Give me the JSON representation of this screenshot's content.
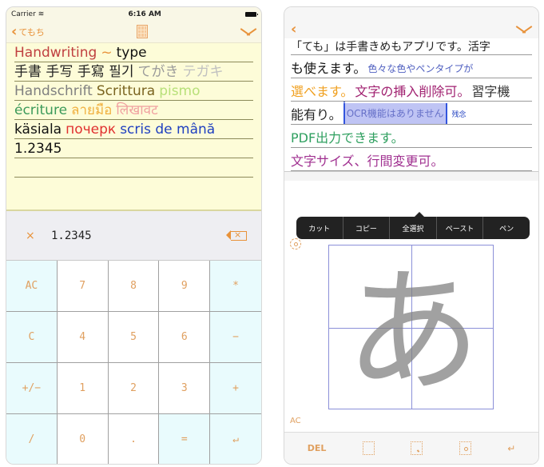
{
  "left": {
    "status": {
      "carrier": "Carrier",
      "wifi_icon": "wifi-icon",
      "time": "6:16 AM",
      "battery_icon": "battery-icon"
    },
    "nav": {
      "back_label": "てもち",
      "calc_icon": "calculator-icon",
      "collapse_icon": "chevron-down-icon"
    },
    "note_lines": [
      [
        {
          "text": "Handwriting",
          "color": "#c04040"
        },
        {
          "text": "~",
          "color": "#e8923a"
        },
        {
          "text": "type",
          "color": "#111111"
        }
      ],
      [
        {
          "text": "手書 手写 手寫 필기",
          "color": "#222222"
        },
        {
          "text": "てがき",
          "color": "#9a9a9a"
        },
        {
          "text": "テガキ",
          "color": "#c0c0c0"
        }
      ],
      [
        {
          "text": "Handschrift",
          "color": "#808080"
        },
        {
          "text": "Scrittura",
          "color": "#7a6420"
        },
        {
          "text": "pismo",
          "color": "#b8e07a"
        }
      ],
      [
        {
          "text": "écriture",
          "color": "#3c9a5a"
        },
        {
          "text": "ลายมือ",
          "color": "#f0b040"
        },
        {
          "text": "लिखावट",
          "color": "#f0a0a0"
        }
      ],
      [
        {
          "text": "käsiala",
          "color": "#111111"
        },
        {
          "text": "почерк",
          "color": "#e03030"
        },
        {
          "text": "scris de mână",
          "color": "#2040c0"
        }
      ],
      [
        {
          "text": "1.2345",
          "color": "#111111"
        }
      ],
      []
    ],
    "calculator": {
      "operator": "×",
      "value": "1.2345",
      "backspace_icon": "backspace-icon",
      "keys": [
        "AC",
        "7",
        "8",
        "9",
        "*",
        "C",
        "4",
        "5",
        "6",
        "−",
        "+/−",
        "1",
        "2",
        "3",
        "+",
        "/",
        "0",
        ".",
        "=",
        "↵"
      ]
    }
  },
  "right": {
    "nav": {
      "back_icon": "chevron-left-icon",
      "collapse_icon": "chevron-down-icon"
    },
    "lines": [
      {
        "segments": [
          {
            "text": "「ても」は手書きめもアプリです。活字",
            "color": "#222222"
          }
        ]
      },
      {
        "segments": [
          {
            "text": "も使えます。",
            "color": "#111111"
          },
          {
            "text": "色々な色やペンタイプが",
            "color": "#5060c0"
          }
        ]
      },
      {
        "segments": [
          {
            "text": "選べます。",
            "color": "#f0a020"
          },
          {
            "text": "文字の挿入削除可。",
            "color": "#a02070"
          },
          {
            "text": "習字機",
            "color": "#333333"
          }
        ]
      },
      {
        "segments": [
          {
            "text": "能有り。",
            "color": "#222222"
          }
        ],
        "selection": "OCR機能はありません",
        "after": "残念"
      },
      {
        "segments": [
          {
            "text": "PDF出力できます。",
            "color": "#30a060"
          }
        ]
      },
      {
        "segments": [
          {
            "text": "文字サイズ、行間変更可。",
            "color": "#a03090"
          }
        ]
      }
    ],
    "context_menu": [
      "カット",
      "コピー",
      "全選択",
      "ペースト",
      "ペン"
    ],
    "pad": {
      "settings_icon": "gear-icon",
      "character": "あ",
      "clear_label": "AC"
    },
    "bottom_bar": {
      "delete_label": "DEL",
      "space_icon": "space-box-icon",
      "comma_icon": "comma-box-icon",
      "period_icon": "period-box-icon",
      "enter_icon": "enter-icon"
    }
  }
}
